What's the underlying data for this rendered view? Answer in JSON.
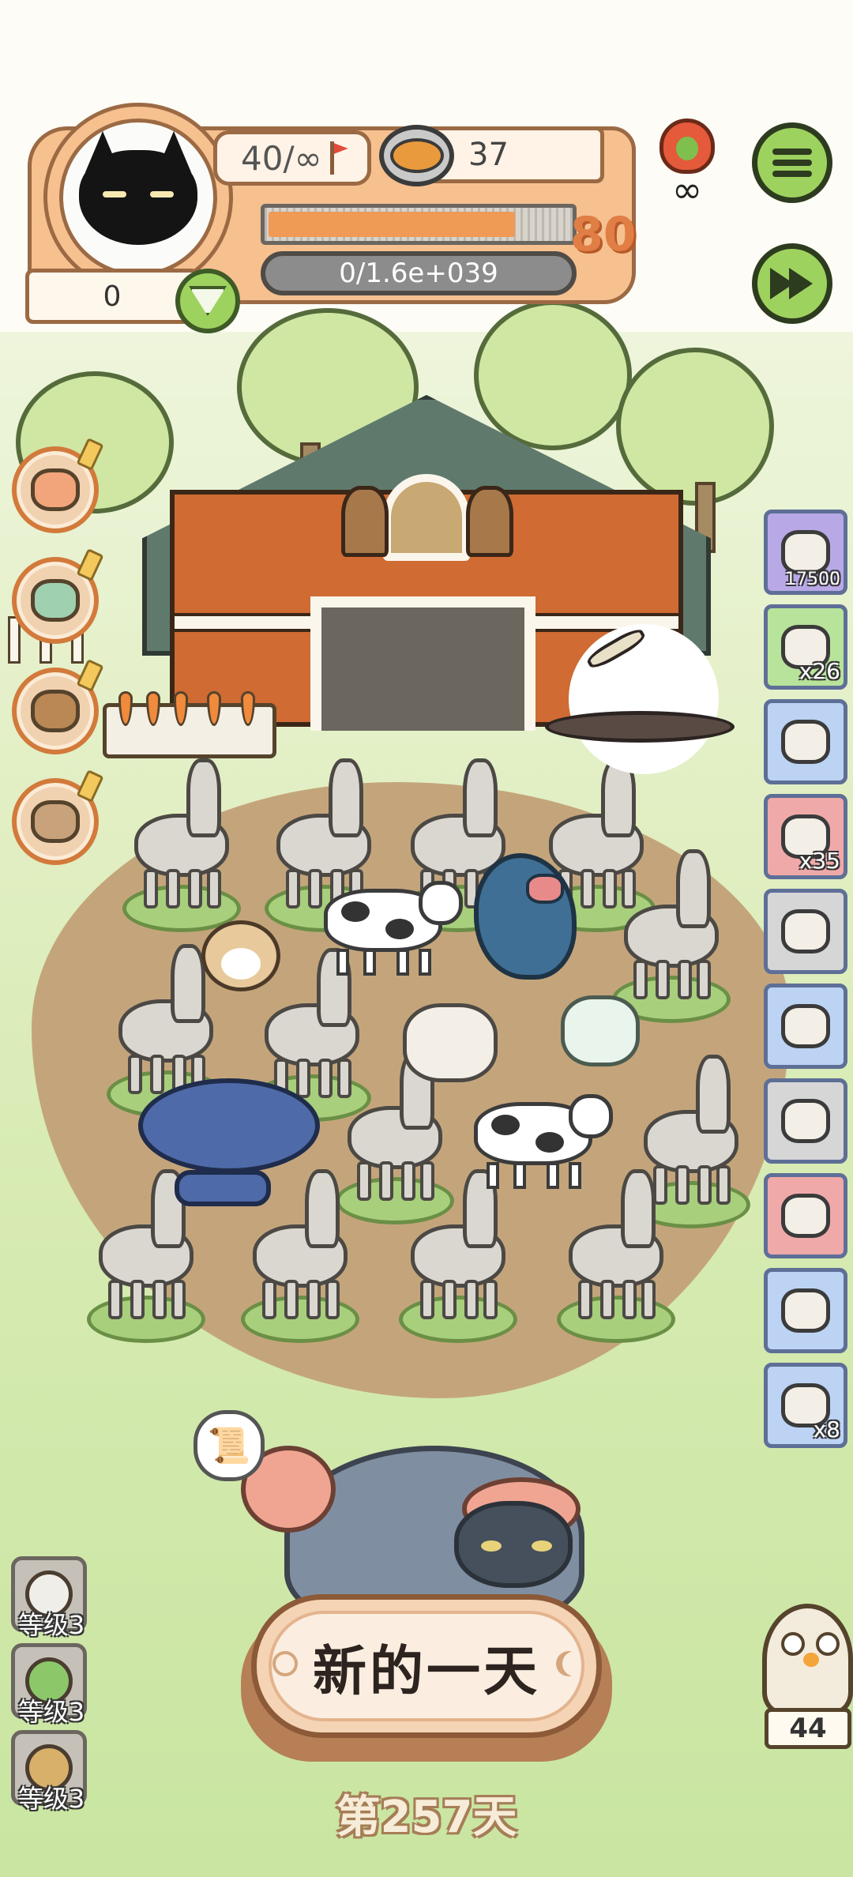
{
  "hud": {
    "stamina": "40/∞",
    "food_count": "37",
    "level": "80",
    "level_progress": 0.82,
    "exp": "0/1.6e+039",
    "coins": "0",
    "infinity": "∞"
  },
  "icons": {
    "avatar": "black-cat-icon",
    "stamina": "flag-icon",
    "food": "food-bowl-icon",
    "coins": "heart-icon",
    "flame": "flame-icon",
    "menu": "menu-icon",
    "fast_forward": "fast-forward-icon"
  },
  "left_menu": [
    {
      "name": "goldfish-icon",
      "color": "#f2a57a"
    },
    {
      "name": "ball-icon",
      "color": "#9fd0b0"
    },
    {
      "name": "satchel-icon",
      "color": "#b98855"
    },
    {
      "name": "box-icon",
      "color": "#c8a27a"
    }
  ],
  "inventory": [
    {
      "name": "film-reel-icon",
      "count": "17500",
      "bg": "#b9a8e6"
    },
    {
      "name": "tent-icon",
      "count": "x26",
      "bg": "#b8e39a"
    },
    {
      "name": "straw-hut-icon",
      "count": "",
      "bg": "#bcd3f4"
    },
    {
      "name": "camera-icon",
      "count": "x35",
      "bg": "#f0a9a9"
    },
    {
      "name": "funnel-icon",
      "count": "",
      "bg": "#d6d6d6"
    },
    {
      "name": "sheep-plate-icon",
      "count": "",
      "bg": "#bcd3f4"
    },
    {
      "name": "horn-icon",
      "count": "",
      "bg": "#d6d6d6"
    },
    {
      "name": "bone-jar-icon",
      "count": "",
      "bg": "#f0a9a9"
    },
    {
      "name": "wool-wig-icon",
      "count": "",
      "bg": "#bcd3f4"
    },
    {
      "name": "can-icon",
      "count": "x8",
      "bg": "#bcd3f4"
    }
  ],
  "levels": [
    {
      "label": "等级3",
      "icon": "chicken-icon"
    },
    {
      "label": "等级3",
      "icon": "sprout-icon"
    },
    {
      "label": "等级3",
      "icon": "paw-icon"
    }
  ],
  "owl_count": "44",
  "new_day_label": "新的一天",
  "day_counter": "第257天",
  "colors": {
    "accent_green": "#9ed25e",
    "hud_orange": "#f6c08f",
    "level_orange": "#e07e46"
  }
}
